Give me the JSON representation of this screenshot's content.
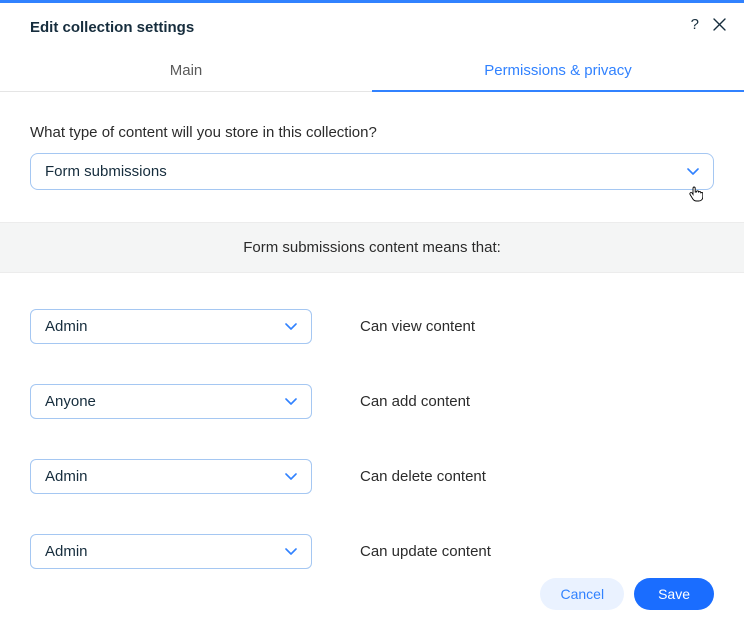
{
  "header": {
    "title": "Edit collection settings"
  },
  "tabs": {
    "main": "Main",
    "permissions": "Permissions & privacy"
  },
  "content": {
    "prompt": "What type of content will you store in this collection?",
    "content_type_selected": "Form submissions",
    "banner": "Form submissions content means that:"
  },
  "permissions": [
    {
      "role": "Admin",
      "label": "Can view content"
    },
    {
      "role": "Anyone",
      "label": "Can add content"
    },
    {
      "role": "Admin",
      "label": "Can delete content"
    },
    {
      "role": "Admin",
      "label": "Can update content"
    }
  ],
  "footer": {
    "cancel": "Cancel",
    "save": "Save"
  }
}
